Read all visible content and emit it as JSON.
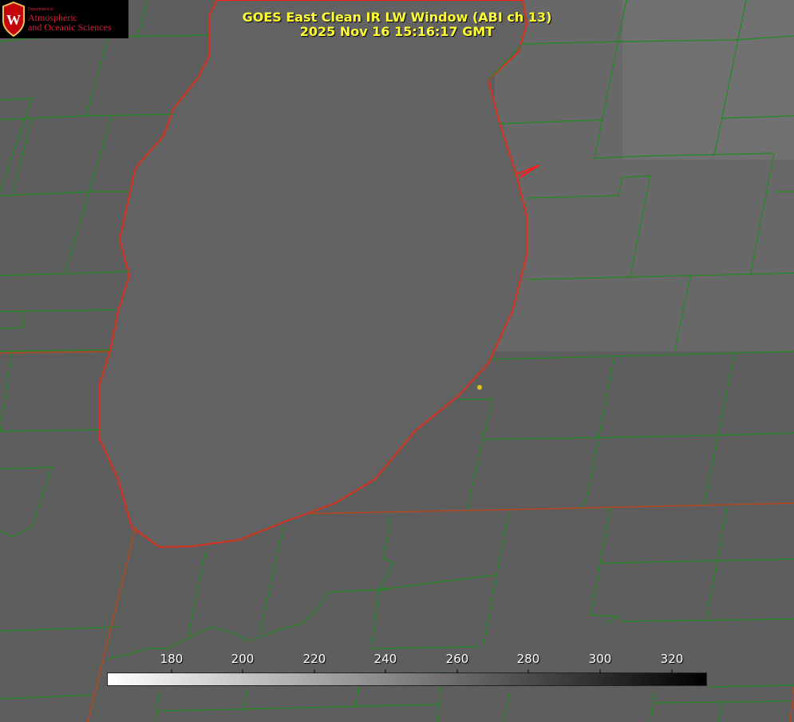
{
  "title": {
    "line1": "GOES East Clean IR LW Window (ABI ch 13)",
    "line2": "2025 Nov 16 15:16:17 GMT"
  },
  "logo": {
    "dept": "Department of",
    "line1": "Atmospheric",
    "line2": "and Oceanic Sciences",
    "emblem": "W"
  },
  "colorbar": {
    "ticks": [
      "180",
      "200",
      "220",
      "240",
      "260",
      "280",
      "300",
      "320"
    ],
    "colors": {
      "start": "#ffffff",
      "end": "#000000"
    }
  },
  "colors": {
    "background": "#5e5e5e",
    "lake": "#626262",
    "county_lines": "#1f8a1f",
    "state_lines": "#b5481c",
    "coastline": "#ff1a1a",
    "title_text": "#ffff33",
    "marker": "#d9c41a"
  }
}
